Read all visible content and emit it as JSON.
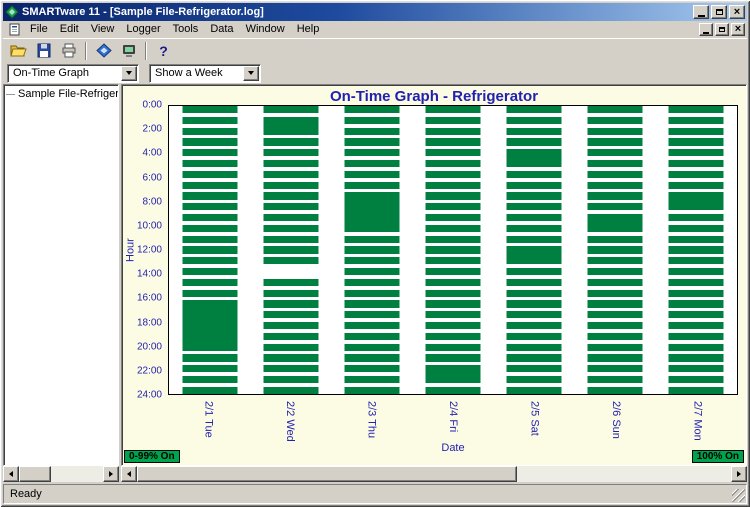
{
  "window": {
    "title": "SMARTware 11 - [Sample File-Refrigerator.log]",
    "status_text": "Ready",
    "close_glyph": "×"
  },
  "menu": {
    "items": [
      "File",
      "Edit",
      "View",
      "Logger",
      "Tools",
      "Data",
      "Window",
      "Help"
    ]
  },
  "toolbar": {
    "buttons": [
      "open",
      "save",
      "print",
      "connect",
      "logger",
      "help"
    ],
    "help_glyph": "?"
  },
  "selectors": {
    "graph_type": {
      "value": "On-Time Graph"
    },
    "range": {
      "value": "Show a Week"
    }
  },
  "sidebar": {
    "items": [
      {
        "label": "Sample File-Refrigerato"
      }
    ]
  },
  "colors": {
    "bar": "#008040",
    "legend": "#00A24C",
    "accent_text": "#2222B2",
    "chart_bg": "#FCFBE3"
  },
  "chart_data": {
    "type": "bar",
    "subtype": "on-time schedule (green = logger ON, hour-of-day vs date)",
    "title": "On-Time Graph - Refrigerator",
    "xlabel": "Date",
    "ylabel": "Hour",
    "y_ticks": [
      "0:00",
      "2:00",
      "4:00",
      "6:00",
      "8:00",
      "10:00",
      "12:00",
      "14:00",
      "16:00",
      "18:00",
      "20:00",
      "22:00",
      "24:00"
    ],
    "y_range_hours": [
      0,
      24
    ],
    "bar_color": "#008040",
    "legend": [
      {
        "label": "0-99% On",
        "color": "#00A24C"
      },
      {
        "label": "100% On",
        "color": "#00A24C"
      }
    ],
    "days": [
      {
        "label": "2/1 Tue",
        "segments": [
          [
            0,
            0.6
          ],
          [
            0.9,
            1.5
          ],
          [
            1.8,
            2.4
          ],
          [
            2.7,
            3.3
          ],
          [
            3.6,
            4.2
          ],
          [
            4.5,
            5.1
          ],
          [
            5.4,
            6.0
          ],
          [
            6.3,
            6.9
          ],
          [
            7.2,
            7.8
          ],
          [
            8.1,
            8.7
          ],
          [
            9.0,
            9.6
          ],
          [
            9.9,
            10.5
          ],
          [
            10.8,
            11.4
          ],
          [
            11.7,
            12.3
          ],
          [
            12.6,
            13.2
          ],
          [
            13.5,
            14.1
          ],
          [
            14.4,
            15.0
          ],
          [
            15.3,
            15.9
          ],
          [
            16.2,
            20.4
          ],
          [
            20.7,
            21.3
          ],
          [
            21.6,
            22.2
          ],
          [
            22.5,
            23.1
          ],
          [
            23.4,
            24.0
          ]
        ]
      },
      {
        "label": "2/2 Wed",
        "segments": [
          [
            0,
            0.6
          ],
          [
            0.9,
            2.4
          ],
          [
            2.7,
            3.3
          ],
          [
            3.6,
            4.2
          ],
          [
            4.5,
            5.1
          ],
          [
            5.4,
            6.0
          ],
          [
            6.3,
            6.9
          ],
          [
            7.2,
            7.8
          ],
          [
            8.1,
            8.7
          ],
          [
            9.0,
            9.6
          ],
          [
            9.9,
            10.5
          ],
          [
            10.8,
            11.4
          ],
          [
            11.7,
            12.3
          ],
          [
            12.6,
            13.2
          ],
          [
            14.4,
            15.0
          ],
          [
            15.3,
            15.9
          ],
          [
            16.2,
            16.8
          ],
          [
            17.1,
            17.7
          ],
          [
            18.0,
            18.6
          ],
          [
            18.9,
            19.5
          ],
          [
            19.8,
            20.4
          ],
          [
            20.7,
            21.3
          ],
          [
            21.6,
            22.2
          ],
          [
            22.5,
            23.1
          ],
          [
            23.4,
            24.0
          ]
        ]
      },
      {
        "label": "2/3 Thu",
        "segments": [
          [
            0,
            0.6
          ],
          [
            0.9,
            1.5
          ],
          [
            1.8,
            2.4
          ],
          [
            2.7,
            3.3
          ],
          [
            3.6,
            4.2
          ],
          [
            4.5,
            5.1
          ],
          [
            5.4,
            6.0
          ],
          [
            6.3,
            6.9
          ],
          [
            7.2,
            10.5
          ],
          [
            10.8,
            11.4
          ],
          [
            11.7,
            12.3
          ],
          [
            12.6,
            13.2
          ],
          [
            13.5,
            14.1
          ],
          [
            14.4,
            15.0
          ],
          [
            15.3,
            15.9
          ],
          [
            16.2,
            16.8
          ],
          [
            17.1,
            17.7
          ],
          [
            18.0,
            18.6
          ],
          [
            18.9,
            19.5
          ],
          [
            19.8,
            20.4
          ],
          [
            20.7,
            21.3
          ],
          [
            21.6,
            22.2
          ],
          [
            22.5,
            23.1
          ],
          [
            23.4,
            24.0
          ]
        ]
      },
      {
        "label": "2/4 Fri",
        "segments": [
          [
            0,
            0.6
          ],
          [
            0.9,
            1.5
          ],
          [
            1.8,
            2.4
          ],
          [
            2.7,
            3.3
          ],
          [
            3.6,
            4.2
          ],
          [
            4.5,
            5.1
          ],
          [
            5.4,
            6.0
          ],
          [
            6.3,
            6.9
          ],
          [
            7.2,
            7.8
          ],
          [
            8.1,
            8.7
          ],
          [
            9.0,
            9.6
          ],
          [
            9.9,
            10.5
          ],
          [
            10.8,
            11.4
          ],
          [
            11.7,
            12.3
          ],
          [
            12.6,
            13.2
          ],
          [
            13.5,
            14.1
          ],
          [
            14.4,
            15.0
          ],
          [
            15.3,
            15.9
          ],
          [
            16.2,
            16.8
          ],
          [
            17.1,
            17.7
          ],
          [
            18.0,
            18.6
          ],
          [
            18.9,
            19.5
          ],
          [
            19.8,
            20.4
          ],
          [
            20.7,
            21.3
          ],
          [
            21.6,
            23.1
          ],
          [
            23.4,
            24.0
          ]
        ]
      },
      {
        "label": "2/5 Sat",
        "segments": [
          [
            0,
            0.6
          ],
          [
            0.9,
            1.5
          ],
          [
            1.8,
            2.4
          ],
          [
            2.7,
            3.3
          ],
          [
            3.6,
            5.1
          ],
          [
            5.4,
            6.0
          ],
          [
            6.3,
            6.9
          ],
          [
            7.2,
            7.8
          ],
          [
            8.1,
            8.7
          ],
          [
            9.0,
            9.6
          ],
          [
            9.9,
            10.5
          ],
          [
            10.8,
            11.4
          ],
          [
            11.7,
            13.2
          ],
          [
            13.5,
            14.1
          ],
          [
            14.4,
            15.0
          ],
          [
            15.3,
            15.9
          ],
          [
            16.2,
            16.8
          ],
          [
            17.1,
            17.7
          ],
          [
            18.0,
            18.6
          ],
          [
            18.9,
            19.5
          ],
          [
            19.8,
            20.4
          ],
          [
            20.7,
            21.3
          ],
          [
            21.6,
            22.2
          ],
          [
            22.5,
            23.1
          ],
          [
            23.4,
            24.0
          ]
        ]
      },
      {
        "label": "2/6 Sun",
        "segments": [
          [
            0,
            0.6
          ],
          [
            0.9,
            1.5
          ],
          [
            1.8,
            2.4
          ],
          [
            2.7,
            3.3
          ],
          [
            3.6,
            4.2
          ],
          [
            4.5,
            5.1
          ],
          [
            5.4,
            6.0
          ],
          [
            6.3,
            6.9
          ],
          [
            7.2,
            7.8
          ],
          [
            8.1,
            8.7
          ],
          [
            9.0,
            10.5
          ],
          [
            10.8,
            11.4
          ],
          [
            11.7,
            12.3
          ],
          [
            12.6,
            13.2
          ],
          [
            13.5,
            14.1
          ],
          [
            14.4,
            15.0
          ],
          [
            15.3,
            15.9
          ],
          [
            16.2,
            16.8
          ],
          [
            17.1,
            17.7
          ],
          [
            18.0,
            18.6
          ],
          [
            18.9,
            19.5
          ],
          [
            19.8,
            20.4
          ],
          [
            20.7,
            21.3
          ],
          [
            21.6,
            22.2
          ],
          [
            22.5,
            23.1
          ],
          [
            23.4,
            24.0
          ]
        ]
      },
      {
        "label": "2/7 Mon",
        "segments": [
          [
            0,
            0.6
          ],
          [
            0.9,
            1.5
          ],
          [
            1.8,
            2.4
          ],
          [
            2.7,
            3.3
          ],
          [
            3.6,
            4.2
          ],
          [
            4.5,
            5.1
          ],
          [
            5.4,
            6.0
          ],
          [
            6.3,
            6.9
          ],
          [
            7.2,
            8.7
          ],
          [
            9.0,
            9.6
          ],
          [
            9.9,
            10.5
          ],
          [
            10.8,
            11.4
          ],
          [
            11.7,
            12.3
          ],
          [
            12.6,
            13.2
          ],
          [
            13.5,
            14.1
          ],
          [
            14.4,
            15.0
          ],
          [
            15.3,
            15.9
          ],
          [
            16.2,
            16.8
          ],
          [
            17.1,
            17.7
          ],
          [
            18.0,
            18.6
          ],
          [
            18.9,
            19.5
          ],
          [
            19.8,
            20.4
          ],
          [
            20.7,
            21.3
          ],
          [
            21.6,
            22.2
          ],
          [
            22.5,
            23.1
          ],
          [
            23.4,
            24.0
          ]
        ]
      }
    ]
  }
}
